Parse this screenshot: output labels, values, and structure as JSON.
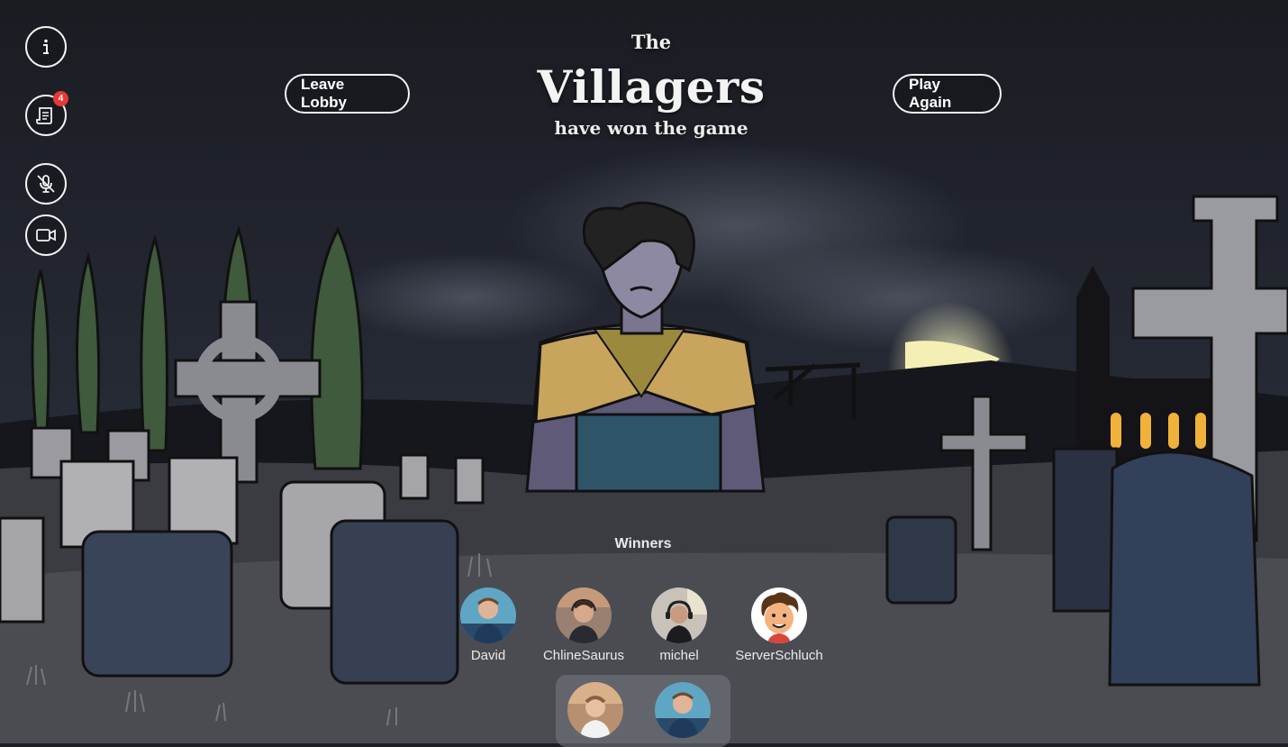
{
  "sidebar": {
    "info_icon": "info-icon",
    "log_icon": "scroll-log-icon",
    "log_badge": "4",
    "mic_icon": "mic-muted-icon",
    "video_icon": "video-camera-icon"
  },
  "header": {
    "leave_label": "Leave Lobby",
    "play_again_label": "Play Again",
    "title_pre": "The",
    "title_main": "Villagers",
    "title_sub": "have won the game"
  },
  "winners": {
    "heading": "Winners",
    "players": [
      {
        "name": "David",
        "avatar": "webcam-avatar"
      },
      {
        "name": "ChlineSaurus",
        "avatar": "webcam-avatar"
      },
      {
        "name": "michel",
        "avatar": "webcam-avatar"
      },
      {
        "name": "ServerSchluch",
        "avatar": "cartoon-avatar"
      }
    ]
  },
  "video_tray": {
    "feeds": [
      "webcam-feed",
      "webcam-feed"
    ]
  },
  "colors": {
    "sky": "#1f2230",
    "moon": "#f2eeb0",
    "window_glow": "#f0b23a",
    "badge": "#e53935",
    "tray": "#6f7078"
  }
}
